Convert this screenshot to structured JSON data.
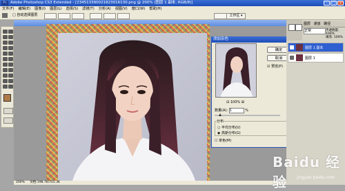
{
  "app": {
    "title": "Adobe Photoshop CS3 Extended - [234513390021823016130.png @ 200% (图层 1 副本, RGB/8)]",
    "logo": "Ps",
    "window_controls": [
      "–",
      "□",
      "×"
    ]
  },
  "menu": [
    "文件(F)",
    "编辑(E)",
    "图像(I)",
    "图层(L)",
    "选择(S)",
    "滤镜(T)",
    "分析(A)",
    "视图(V)",
    "窗口(W)",
    "帮助(H)"
  ],
  "options_bar": {
    "checkbox_label": "□ 自动选择图层",
    "workspace_label": "工作区 ▾"
  },
  "dialog": {
    "title": "添加杂色",
    "ok_label": "确定",
    "cancel_label": "取消",
    "preview_label": "预览(P)",
    "zoom_value": "100%",
    "amount_label": "数量(A):",
    "amount_value": "1",
    "amount_unit": "%",
    "distribution_label": "分布",
    "uniform_label": "平均分布(U)",
    "gaussian_label": "高斯分布(G)",
    "mono_label": "单色(M)"
  },
  "layers_panel": {
    "tabs": [
      "图层",
      "通道",
      "路径"
    ],
    "mode_value": "正常",
    "opacity_label": "不透明度: 100%",
    "fill_label": "填充: 100%",
    "layers": [
      {
        "name": "图层 1 副本",
        "selected": true
      },
      {
        "name": "图层 1",
        "selected": false
      }
    ]
  },
  "status": {
    "zoom": "200%",
    "doc": "文档:198.7K/701.3K"
  },
  "watermark": {
    "text": "Baidu 经验",
    "sub": "jingyan.baidu.com"
  },
  "colors": {
    "accent": "#2f5fd0",
    "title_bar": "#1d4cb8",
    "chrome": "#ece9d8"
  }
}
